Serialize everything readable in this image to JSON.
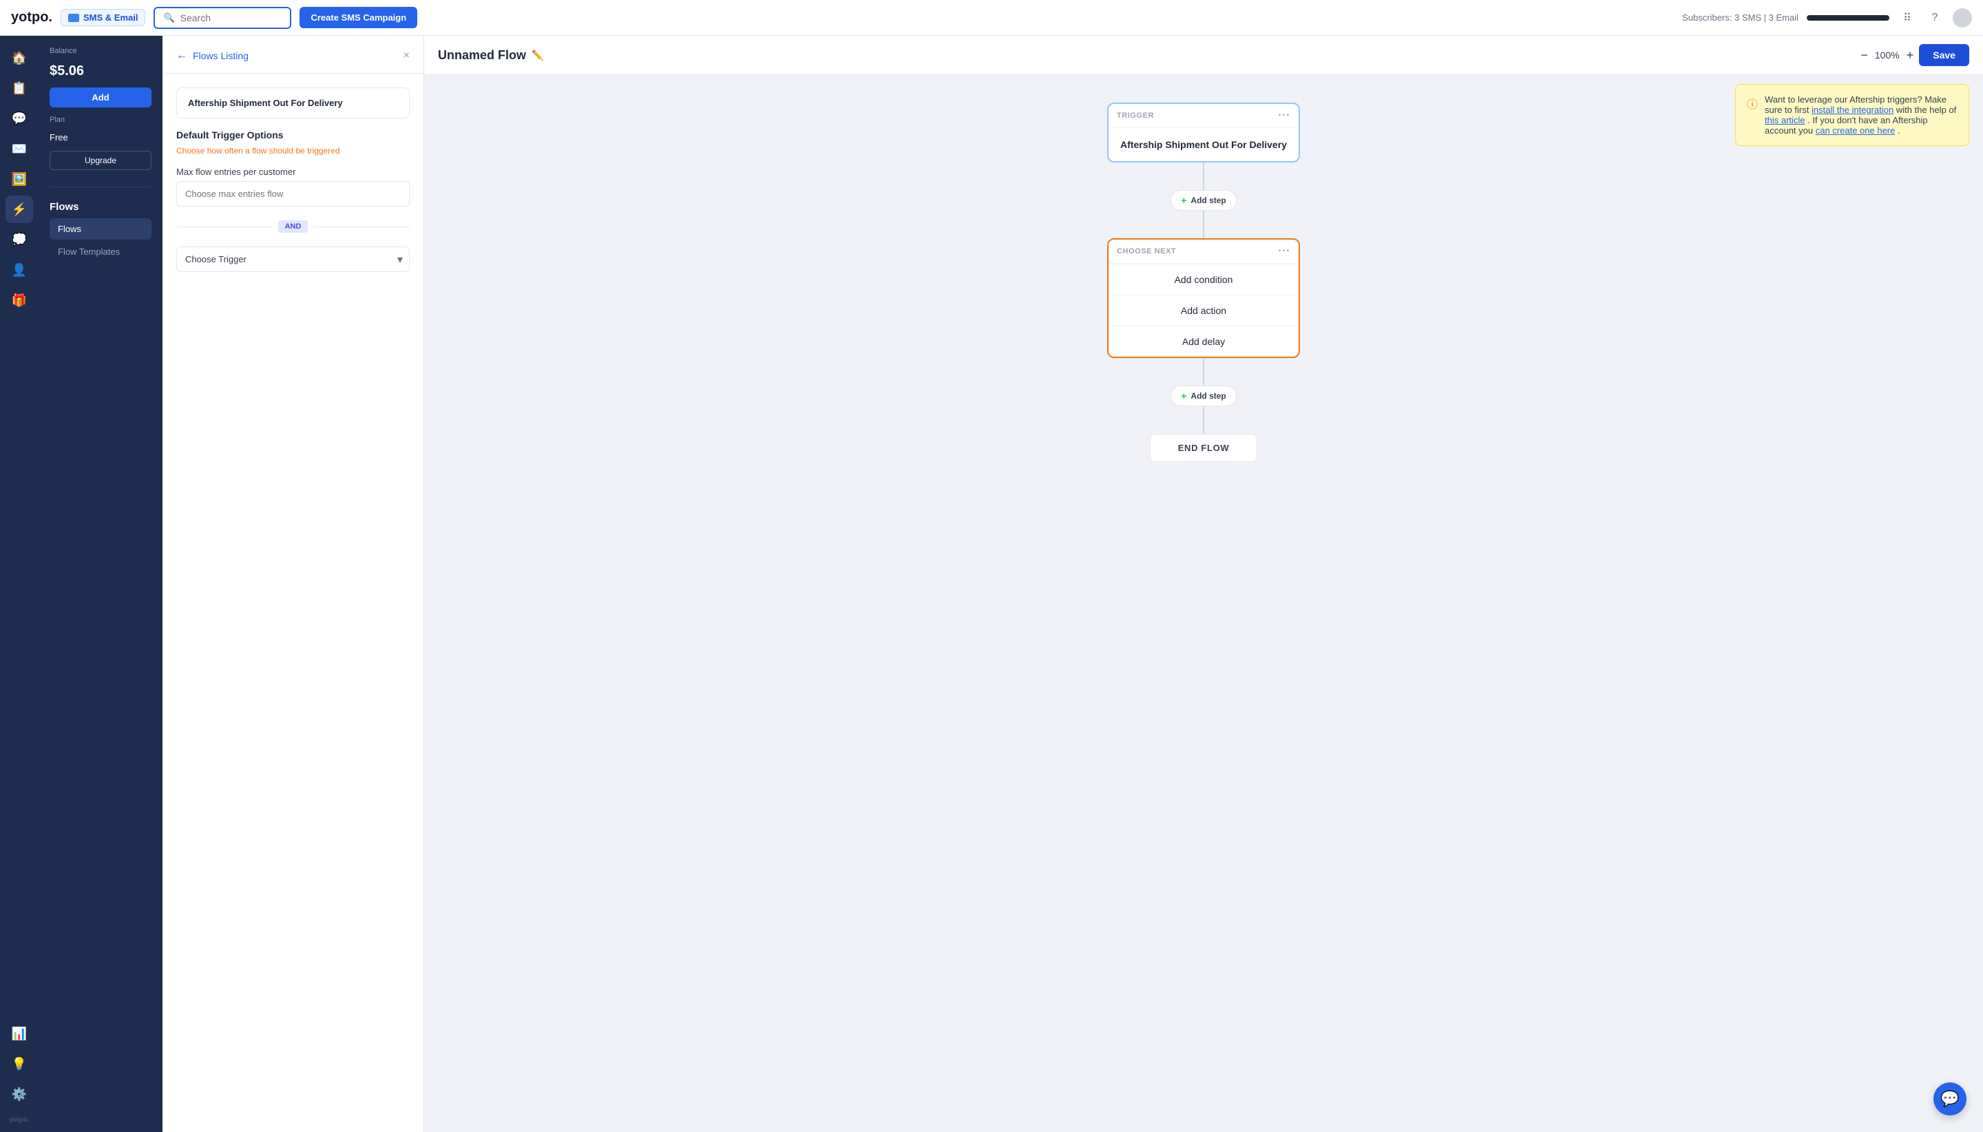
{
  "topnav": {
    "logo_text": "yotpo.",
    "channel_label": "SMS & Email",
    "search_placeholder": "Search",
    "create_btn": "Create SMS Campaign",
    "subscribers_label": "Subscribers:",
    "sms_count": "3 SMS",
    "email_count": "3 Email"
  },
  "sidebar": {
    "balance_label": "Balance",
    "balance_amount": "$5.06",
    "add_btn": "Add",
    "plan_label": "Plan",
    "plan_name": "Free",
    "upgrade_btn": "Upgrade",
    "nav_items": [
      {
        "label": "Flows",
        "active": true
      },
      {
        "label": "Flow Templates",
        "active": false
      }
    ],
    "section_title": "Flows"
  },
  "middle_panel": {
    "breadcrumb": "Flows Listing",
    "trigger_name": "Aftership Shipment Out For Delivery",
    "close_label": "×",
    "section_title": "Default Trigger Options",
    "section_subtitle": "Choose how often a flow should be triggered",
    "max_entries_label": "Max flow entries per customer",
    "max_entries_placeholder": "Choose max entries flow",
    "and_label": "AND",
    "choose_trigger_placeholder": "Choose Trigger"
  },
  "canvas": {
    "flow_title": "Unnamed Flow",
    "zoom_level": "100%",
    "save_label": "Save",
    "trigger_node": {
      "header": "TRIGGER",
      "body": "Aftership Shipment Out For Delivery"
    },
    "add_step_label": "+ Add step",
    "choose_next_node": {
      "header": "CHOOSE NEXT",
      "items": [
        "Add condition",
        "Add action",
        "Add delay"
      ]
    },
    "add_step_label2": "+ Add step",
    "end_flow_label": "END FLOW"
  },
  "info_banner": {
    "text_before": "Want to leverage our Aftership triggers? Make sure to first ",
    "link1": "install the integration",
    "text_middle": " with the help of ",
    "link2": "this article",
    "text_after": ". If you don't have an Aftership account you ",
    "link3": "can create one here",
    "text_end": "."
  },
  "chat": {
    "icon": "💬"
  }
}
